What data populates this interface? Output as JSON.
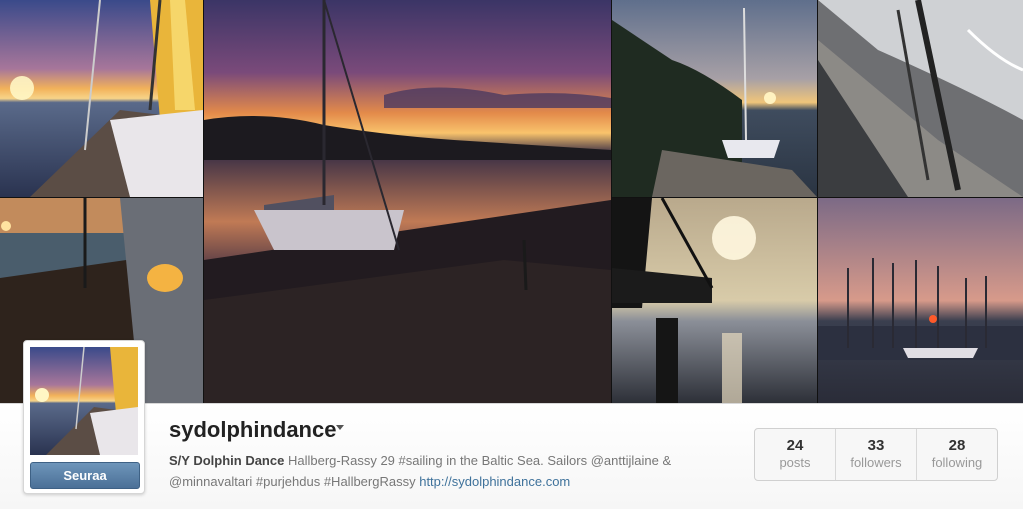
{
  "profile": {
    "username": "sydolphindance",
    "follow_label": "Seuraa",
    "bio_name": "S/Y Dolphin Dance",
    "bio_text": "Hallberg-Rassy 29 #sailing in the Baltic Sea. Sailors @anttijlaine & @minnavaltari #purjehdus #HallbergRassy",
    "website": "http://sydolphindance.com"
  },
  "stats": [
    {
      "count": "24",
      "label": "posts"
    },
    {
      "count": "33",
      "label": "followers"
    },
    {
      "count": "28",
      "label": "following"
    }
  ],
  "icons": {
    "dropdown": "chevron-down-icon"
  },
  "colors": {
    "follow_button": "#5a7fa6",
    "link": "#3f729b"
  }
}
